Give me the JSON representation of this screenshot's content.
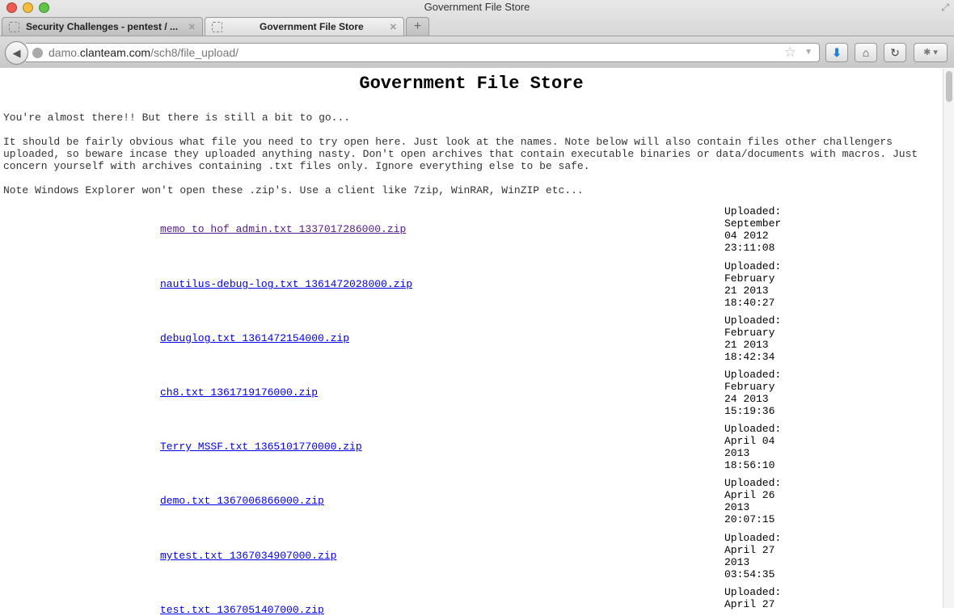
{
  "window": {
    "title": "Government File Store"
  },
  "tabs": [
    {
      "label": "Security Challenges - pentest / ..."
    },
    {
      "label": "Government File Store"
    }
  ],
  "new_tab": "+",
  "address": {
    "pre": "damo.",
    "domain": "clanteam.com",
    "path": "/sch8/file_upload/"
  },
  "page": {
    "heading": "Government File Store",
    "intro": "You're almost there!! But there is still a bit to go...",
    "para": "It should be fairly obvious what file you need to try open here. Just look at the names. Note below will also contain files other challengers uploaded, so beware incase they uploaded anything nasty. Don't open archives that contain executable binaries or data/documents with macros. Just concern yourself with archives containing .txt files only. Ignore everything else to be safe.",
    "note": "Note Windows Explorer won't open these .zip's. Use a client like 7zip, WinRAR, WinZIP etc...",
    "files": [
      {
        "name": "memo_to_hof_admin.txt_1337017286000.zip",
        "l1": "Uploaded:",
        "l2": "September",
        "l3": "04 2012",
        "l4": "23:11:08"
      },
      {
        "name": "nautilus-debug-log.txt_1361472028000.zip",
        "l1": "Uploaded:",
        "l2": "February",
        "l3": "21 2013",
        "l4": "18:40:27"
      },
      {
        "name": "debuglog.txt_1361472154000.zip",
        "l1": "Uploaded:",
        "l2": "February",
        "l3": "21 2013",
        "l4": "18:42:34"
      },
      {
        "name": "ch8.txt_1361719176000.zip",
        "l1": "Uploaded:",
        "l2": "February",
        "l3": "24 2013",
        "l4": "15:19:36"
      },
      {
        "name": "Terry_MSSF.txt_1365101770000.zip",
        "l1": "Uploaded:",
        "l2": "April 04",
        "l3": "2013",
        "l4": "18:56:10"
      },
      {
        "name": "demo.txt_1367006866000.zip",
        "l1": "Uploaded:",
        "l2": "April 26",
        "l3": "2013",
        "l4": "20:07:15"
      },
      {
        "name": "mytest.txt_1367034907000.zip",
        "l1": "Uploaded:",
        "l2": "April 27",
        "l3": "2013",
        "l4": "03:54:35"
      },
      {
        "name": "test.txt_1367051407000.zip",
        "l1": "Uploaded:",
        "l2": "April 27",
        "l3": "",
        "l4": ""
      }
    ]
  }
}
